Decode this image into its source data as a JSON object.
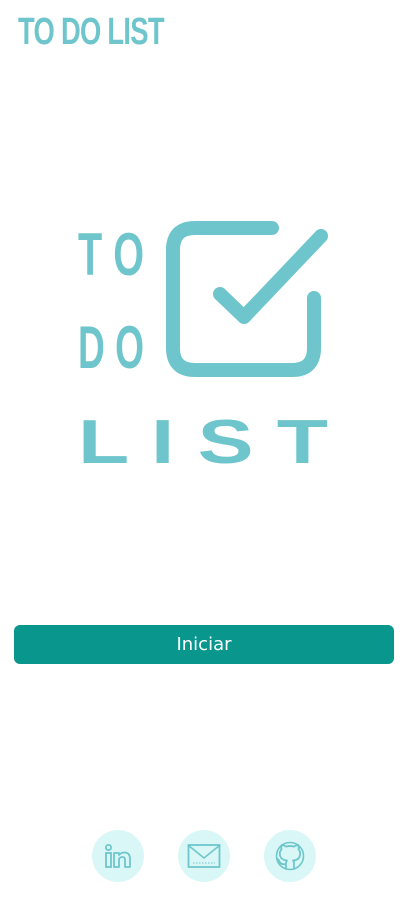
{
  "header": {
    "title": "TO DO LIST"
  },
  "logo": {
    "line1": "T O",
    "line2": "D O",
    "line3": "L I S T",
    "icon": "checkbox-check-icon"
  },
  "main": {
    "start_label": "Iniciar"
  },
  "footer": {
    "links": [
      {
        "icon": "linkedin-icon"
      },
      {
        "icon": "email-icon"
      },
      {
        "icon": "github-icon"
      }
    ]
  },
  "colors": {
    "brand": "#6ec6cc",
    "button": "#08968d",
    "button_text": "#ffffff",
    "social_bg": "#d9f7f6"
  }
}
